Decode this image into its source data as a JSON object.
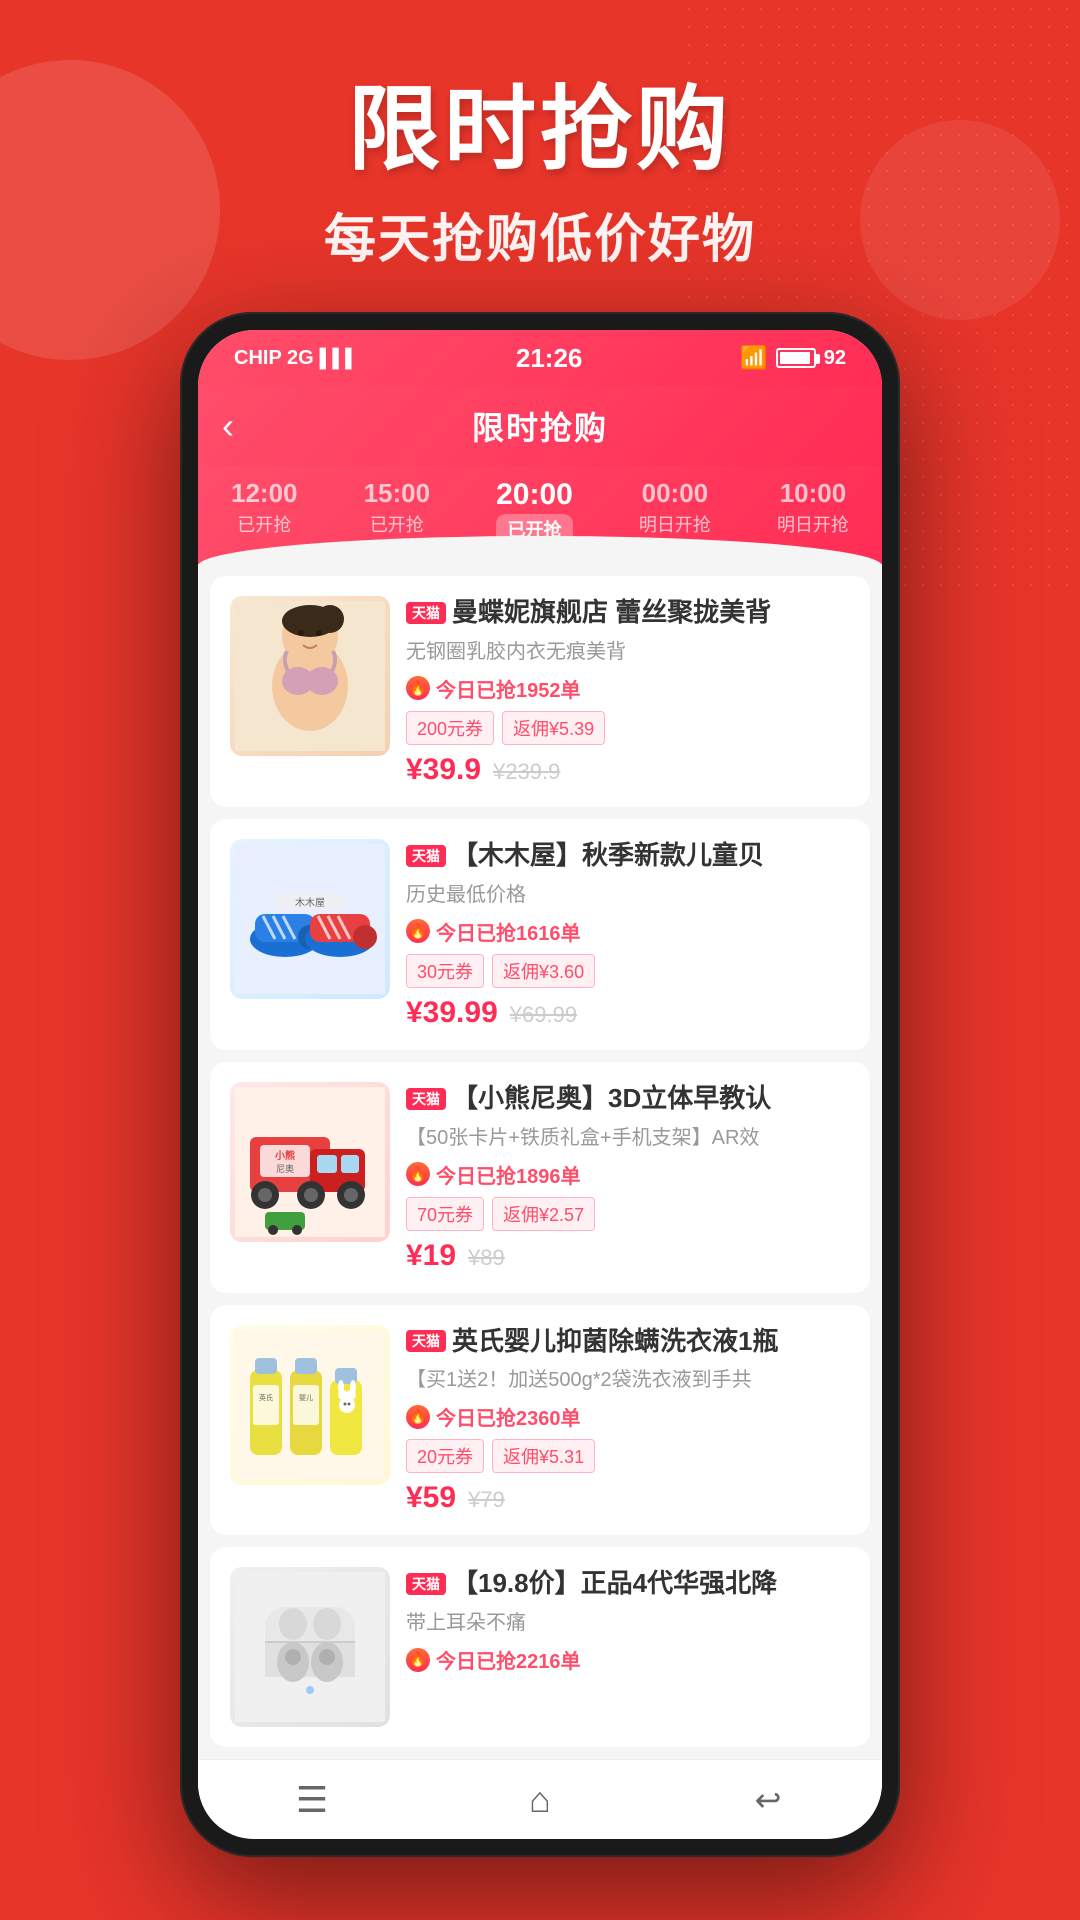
{
  "page": {
    "title": "限时抢购",
    "subtitle": "每天抢购低价好物"
  },
  "status_bar": {
    "carrier": "CHIP 2G",
    "time": "21:26",
    "wifi": "WiFi",
    "battery": "92"
  },
  "app_header": {
    "back_label": "‹",
    "title": "限时抢购"
  },
  "time_tabs": [
    {
      "time": "12:00",
      "status": "已开抢",
      "active": false
    },
    {
      "time": "15:00",
      "status": "已开抢",
      "active": false
    },
    {
      "time": "20:00",
      "status": "已开抢",
      "active": true
    },
    {
      "time": "00:00",
      "status": "明日开抢",
      "active": false
    },
    {
      "time": "10:00",
      "status": "明日开抢",
      "active": false
    }
  ],
  "products": [
    {
      "shop": "天猫",
      "shop_name": "曼蝶妮旗舰店",
      "title": "蕾丝聚拢美背",
      "desc": "无钢圈乳胶内衣无痕美背",
      "grab_count": "今日已抢1952单",
      "coupon": "200元券",
      "cashback": "返佣¥5.39",
      "price_current": "¥39.9",
      "price_original": "¥239.9",
      "image_type": "bra"
    },
    {
      "shop": "天猫",
      "shop_name": "【木木屋】",
      "title": "秋季新款儿童贝",
      "desc": "历史最低价格",
      "grab_count": "今日已抢1616单",
      "coupon": "30元券",
      "cashback": "返佣¥3.60",
      "price_current": "¥39.99",
      "price_original": "¥69.99",
      "image_type": "shoes"
    },
    {
      "shop": "天猫",
      "shop_name": "【小熊尼奥】",
      "title": "3D立体早教认",
      "desc": "【50张卡片+铁质礼盒+手机支架】AR效",
      "grab_count": "今日已抢1896单",
      "coupon": "70元券",
      "cashback": "返佣¥2.57",
      "price_current": "¥19",
      "price_original": "¥89",
      "image_type": "toy"
    },
    {
      "shop": "天猫",
      "shop_name": "英氏婴儿",
      "title": "抑菌除螨洗衣液1瓶",
      "desc": "【买1送2！加送500g*2袋洗衣液到手共",
      "grab_count": "今日已抢2360单",
      "coupon": "20元券",
      "cashback": "返佣¥5.31",
      "price_current": "¥59",
      "price_original": "¥79",
      "image_type": "detergent"
    },
    {
      "shop": "天猫",
      "shop_name": "【19.8价】",
      "title": "正品4代华强北降",
      "desc": "带上耳朵不痛",
      "grab_count": "今日已抢2216单",
      "coupon": "",
      "cashback": "",
      "price_current": "",
      "price_original": "",
      "image_type": "earbuds"
    }
  ],
  "bottom_nav": {
    "menu_label": "menu",
    "home_label": "home",
    "back_label": "back"
  }
}
